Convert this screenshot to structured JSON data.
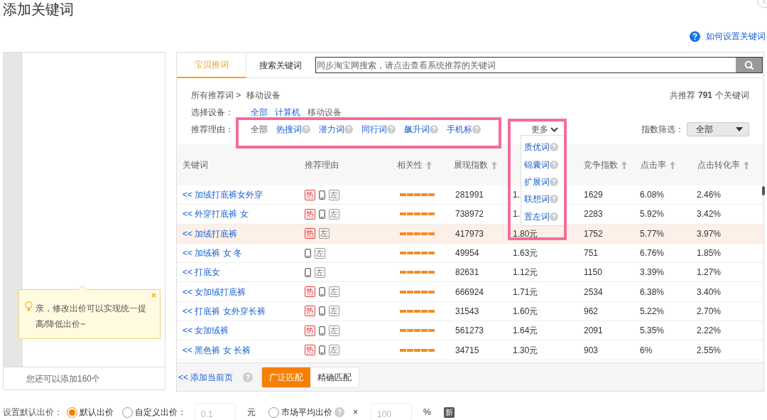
{
  "dialog": {
    "title": "添加关键词",
    "help_link": "如何设置关键词"
  },
  "left_panel": {
    "tip": "亲，修改出价可以实现统一提高/降低出价~",
    "remaining": "您还可以添加160个"
  },
  "tabs": [
    {
      "label": "宝贝推词",
      "selected": true
    },
    {
      "label": "搜索关键词",
      "selected": false
    }
  ],
  "search": {
    "placeholder": "同步淘宝网搜索，请点击查看系统推荐的关键词"
  },
  "breadcrumb": {
    "root": "所有推荐词 >",
    "current": "移动设备"
  },
  "total": {
    "prefix": "共推荐",
    "count": "791",
    "suffix": "个关键词"
  },
  "devices": {
    "label": "选择设备：",
    "options": [
      {
        "label": "全部",
        "selected": false
      },
      {
        "label": "计算机",
        "selected": false
      },
      {
        "label": "移动设备",
        "selected": true
      }
    ]
  },
  "reasons": {
    "label": "推荐理由：",
    "options": [
      {
        "label": "全部",
        "selected": true,
        "help": false
      },
      {
        "label": "热搜词",
        "selected": false,
        "help": true
      },
      {
        "label": "潜力词",
        "selected": false,
        "help": true
      },
      {
        "label": "同行词",
        "selected": false,
        "help": true
      },
      {
        "label": "飙升词",
        "selected": false,
        "help": true
      },
      {
        "label": "手机标",
        "selected": false,
        "help": true
      }
    ]
  },
  "more": {
    "label": "更多",
    "expanded": true,
    "items": [
      "质优词",
      "锦囊词",
      "扩展词",
      "联想词",
      "置左词"
    ]
  },
  "index_filter": {
    "label": "指数筛选：",
    "value": "全部"
  },
  "table": {
    "columns": [
      {
        "label": "关键词",
        "sortable": false
      },
      {
        "label": "推荐理由",
        "sortable": false
      },
      {
        "label": "相关性",
        "sortable": true
      },
      {
        "label": "展现指数",
        "sortable": true
      },
      {
        "label": "竞争指数",
        "sortable": true
      },
      {
        "label": "点击率",
        "sortable": true
      },
      {
        "label": "点击转化率",
        "sortable": true
      }
    ],
    "rows": [
      {
        "keyword": "<< 加绒打底裤女外穿",
        "highlighted": false,
        "tags": [
          {
            "kind": "hot",
            "text": "热"
          },
          {
            "kind": "mobile"
          },
          {
            "kind": "left",
            "text": "左"
          }
        ],
        "stars": 5,
        "impressions": "281991",
        "bid": "1.",
        "competition": "1629",
        "ctr": "6.08%",
        "cvr": "2.46%"
      },
      {
        "keyword": "<< 外穿打底裤 女",
        "highlighted": false,
        "tags": [
          {
            "kind": "hot",
            "text": "热"
          },
          {
            "kind": "mobile"
          },
          {
            "kind": "left",
            "text": "左"
          }
        ],
        "stars": 5,
        "impressions": "738972",
        "bid": "1.",
        "competition": "2283",
        "ctr": "5.92%",
        "cvr": "3.42%"
      },
      {
        "keyword": "<< 加绒打底裤",
        "highlighted": true,
        "tags": [
          {
            "kind": "hot",
            "text": "热"
          },
          {
            "kind": "left",
            "text": "左"
          }
        ],
        "stars": 5,
        "impressions": "417973",
        "bid": "1.80元",
        "competition": "1752",
        "ctr": "5.77%",
        "cvr": "3.97%"
      },
      {
        "keyword": "<< 加绒裤 女 冬",
        "highlighted": false,
        "tags": [
          {
            "kind": "mobile"
          },
          {
            "kind": "left",
            "text": "左"
          }
        ],
        "stars": 5,
        "impressions": "49954",
        "bid": "1.63元",
        "competition": "751",
        "ctr": "6.76%",
        "cvr": "1.85%"
      },
      {
        "keyword": "<< 打底女",
        "highlighted": false,
        "tags": [
          {
            "kind": "mobile"
          },
          {
            "kind": "left",
            "text": "左"
          }
        ],
        "stars": 5,
        "impressions": "82631",
        "bid": "1.12元",
        "competition": "1150",
        "ctr": "3.39%",
        "cvr": "1.27%"
      },
      {
        "keyword": "<< 女加绒打底裤",
        "highlighted": false,
        "tags": [
          {
            "kind": "hot",
            "text": "热"
          },
          {
            "kind": "mobile"
          },
          {
            "kind": "left",
            "text": "左"
          }
        ],
        "stars": 5,
        "impressions": "666924",
        "bid": "1.71元",
        "competition": "2534",
        "ctr": "6.38%",
        "cvr": "3.40%"
      },
      {
        "keyword": "<< 打底裤 女外穿长裤",
        "highlighted": false,
        "tags": [
          {
            "kind": "hot",
            "text": "热"
          },
          {
            "kind": "mobile"
          },
          {
            "kind": "left",
            "text": "左"
          }
        ],
        "stars": 5,
        "impressions": "31543",
        "bid": "1.60元",
        "competition": "962",
        "ctr": "5.22%",
        "cvr": "2.70%"
      },
      {
        "keyword": "<< 女加绒裤",
        "highlighted": false,
        "tags": [
          {
            "kind": "hot",
            "text": "热"
          },
          {
            "kind": "mobile"
          },
          {
            "kind": "left",
            "text": "左"
          }
        ],
        "stars": 5,
        "impressions": "561273",
        "bid": "1.64元",
        "competition": "2091",
        "ctr": "5.35%",
        "cvr": "2.22%"
      },
      {
        "keyword": "<< 黑色裤 女 长裤",
        "highlighted": false,
        "tags": [
          {
            "kind": "hot",
            "text": "热"
          },
          {
            "kind": "mobile"
          },
          {
            "kind": "left",
            "text": "左"
          }
        ],
        "stars": 5,
        "impressions": "34715",
        "bid": "1.30元",
        "competition": "903",
        "ctr": "6%",
        "cvr": "2.55%"
      }
    ]
  },
  "footer": {
    "add_page": "<< 添加当前页",
    "match": [
      {
        "label": "广泛匹配",
        "selected": true
      },
      {
        "label": "精确匹配",
        "selected": false
      }
    ]
  },
  "default_bid": {
    "label": "设置默认出价：",
    "controls": [
      {
        "kind": "radio",
        "label": "默认出价",
        "selected": true,
        "help": false
      },
      {
        "kind": "radio",
        "label": "自定义出价：",
        "selected": false,
        "help": false
      },
      {
        "kind": "field",
        "placeholder": "0.1"
      },
      {
        "kind": "text",
        "text": "元"
      },
      {
        "kind": "radio",
        "label": "市场平均出价",
        "selected": false,
        "help": true
      },
      {
        "kind": "text",
        "text": "×"
      },
      {
        "kind": "field",
        "placeholder": "100"
      },
      {
        "kind": "text",
        "text": "%"
      },
      {
        "kind": "badge",
        "text": "新"
      }
    ]
  }
}
